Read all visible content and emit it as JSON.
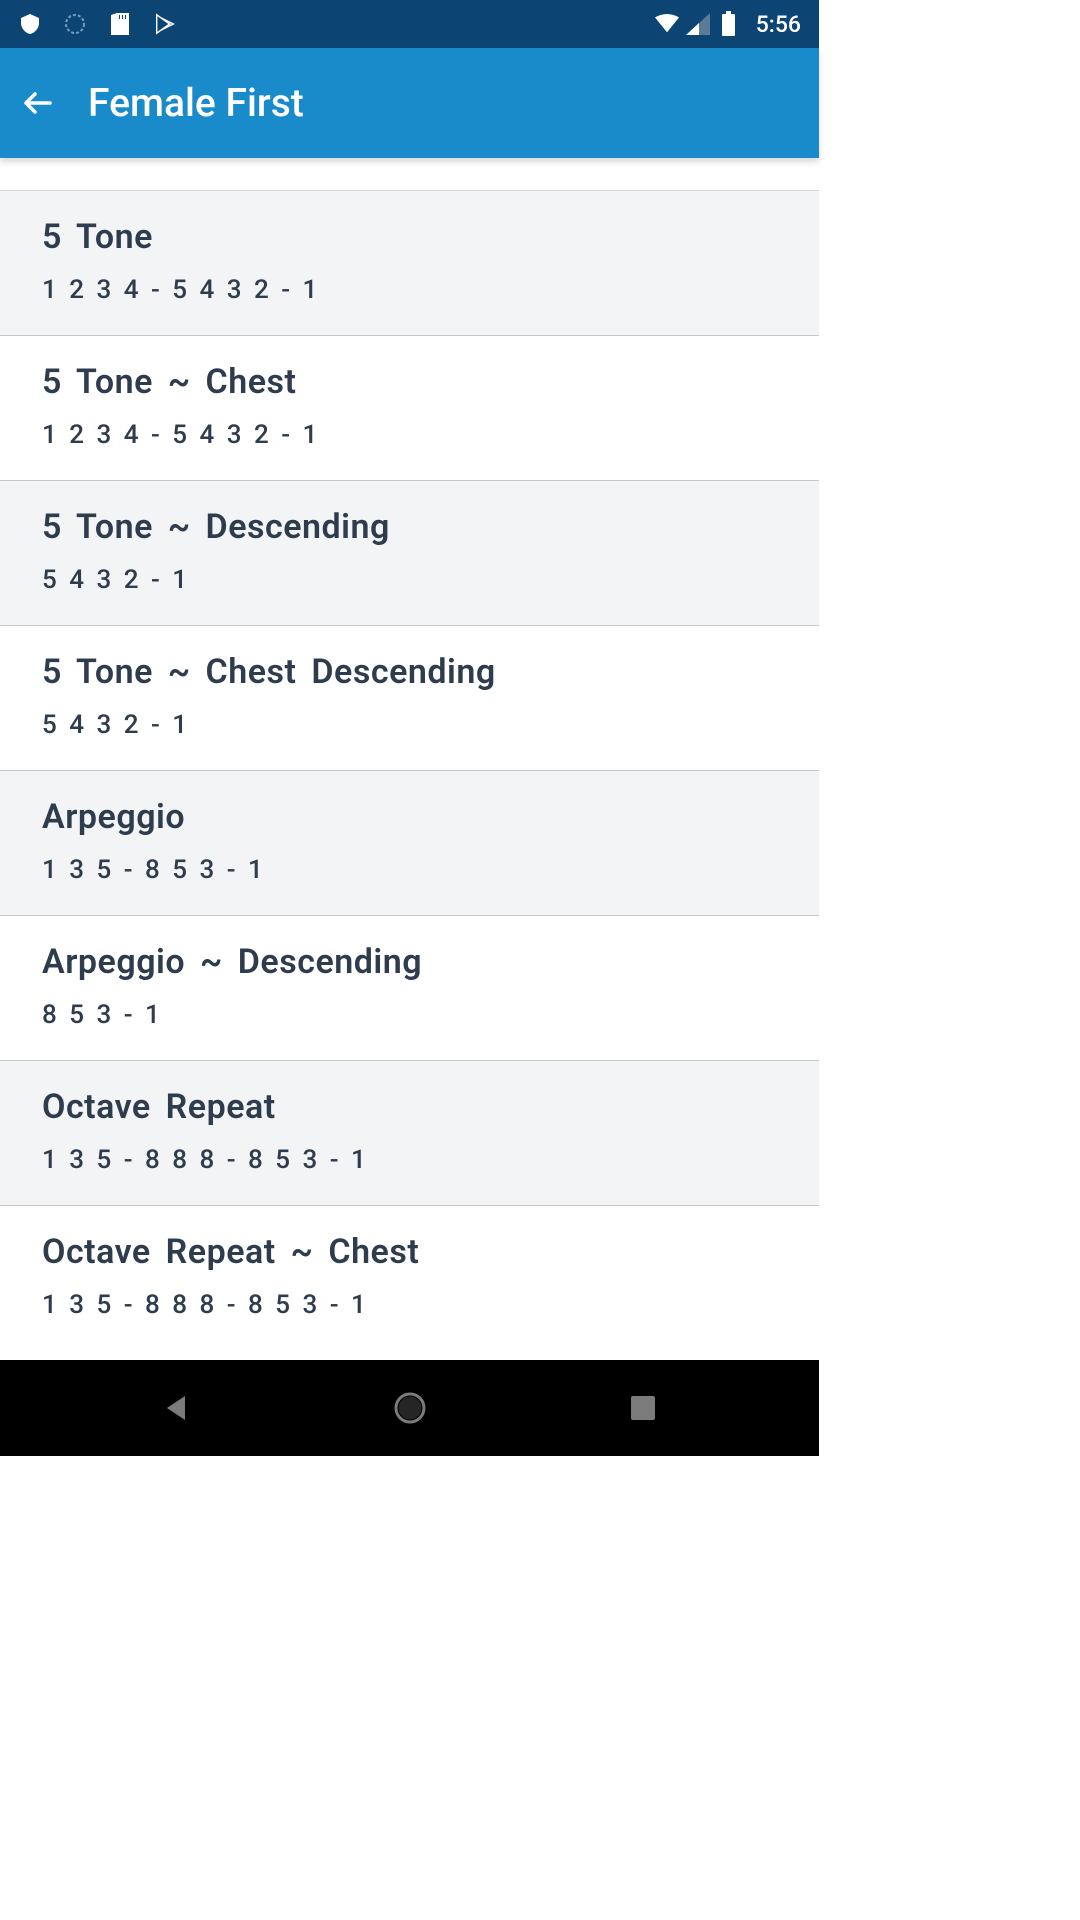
{
  "statusBar": {
    "time": "5:56"
  },
  "appBar": {
    "title": "Female First"
  },
  "items": [
    {
      "title": "5 Tone",
      "subtitle": "1 2 3 4 - 5 4 3 2 - 1"
    },
    {
      "title": "5 Tone ~ Chest",
      "subtitle": "1 2 3 4 - 5 4 3 2 - 1"
    },
    {
      "title": "5 Tone ~ Descending",
      "subtitle": "5 4 3 2 - 1"
    },
    {
      "title": "5 Tone ~ Chest Descending",
      "subtitle": "5 4 3 2 - 1"
    },
    {
      "title": "Arpeggio",
      "subtitle": "1 3 5 - 8 5 3 - 1"
    },
    {
      "title": "Arpeggio ~ Descending",
      "subtitle": "8 5 3 - 1"
    },
    {
      "title": "Octave Repeat",
      "subtitle": "1 3 5 - 8 8 8 - 8 5 3 - 1"
    },
    {
      "title": "Octave Repeat ~ Chest",
      "subtitle": "1 3 5 - 8 8 8 - 8 5 3 - 1"
    }
  ]
}
